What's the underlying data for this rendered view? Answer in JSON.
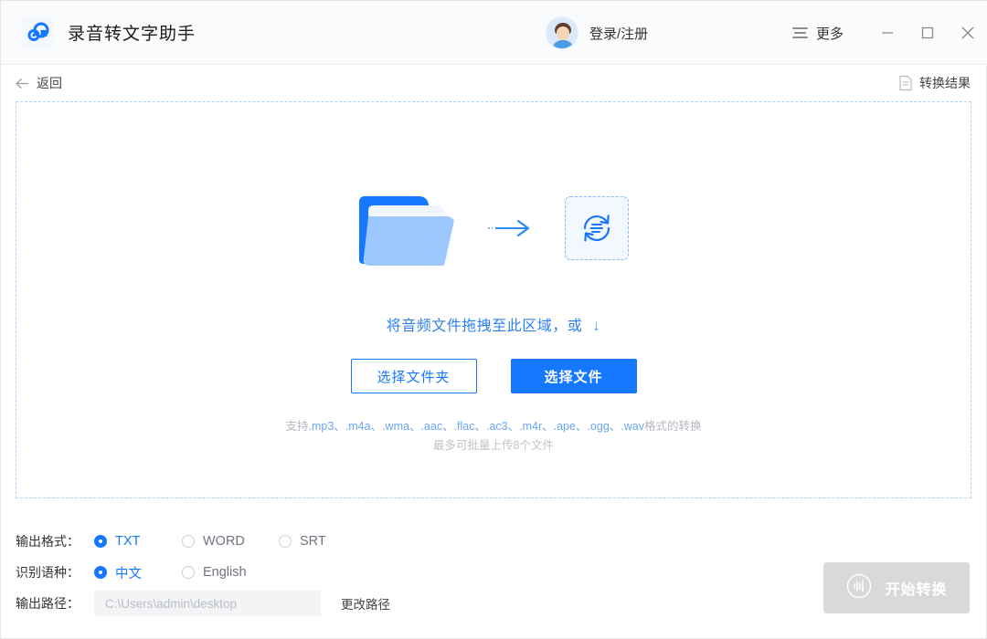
{
  "titlebar": {
    "app_title": "录音转文字助手",
    "logo_icon": "app-logo-icon",
    "avatar_icon": "user-avatar",
    "login_label": "登录/注册",
    "more_label": "更多",
    "more_icon": "hamburger-menu-icon",
    "minimize_icon": "minimize-icon",
    "maximize_icon": "maximize-icon",
    "close_icon": "close-icon"
  },
  "subbar": {
    "back_label": "返回",
    "back_icon": "arrow-left-icon",
    "result_label": "转换结果",
    "result_icon": "document-icon"
  },
  "dropzone": {
    "folder_icon": "folder-icon",
    "arrow_icon": "arrow-right-icon",
    "convert_icon": "convert-circle-icon",
    "hint_text": "将音频文件拖拽至此区域，或",
    "hint_arrow": "↓",
    "select_folder_label": "选择文件夹",
    "select_file_label": "选择文件",
    "formats_prefix": "支持",
    "formats_list": ".mp3、.m4a、.wma、.aac、.flac、.ac3、.m4r、.ape、.ogg、.wav",
    "formats_suffix": "格式的转换",
    "limit_text": "最多可批量上传8个文件"
  },
  "settings": {
    "output_format_label": "输出格式：",
    "output_format_options": [
      {
        "label": "TXT",
        "selected": true
      },
      {
        "label": "WORD",
        "selected": false
      },
      {
        "label": "SRT",
        "selected": false
      }
    ],
    "language_label": "识别语种：",
    "language_options": [
      {
        "label": "中文",
        "selected": true
      },
      {
        "label": "English",
        "selected": false
      }
    ],
    "output_path_label": "输出路径：",
    "output_path_value": "",
    "output_path_placeholder": "C:\\Users\\admin\\desktop",
    "change_path_label": "更改路径"
  },
  "action": {
    "start_label": "开始转换",
    "start_icon": "audio-wave-circle-icon",
    "start_disabled": true
  },
  "colors": {
    "accent": "#1677ff",
    "accent_light": "#9cc8fd",
    "dashed_border": "#afd0f5",
    "disabled_button": "#d9d9d9",
    "titlebar_bg": "#fafbfc"
  }
}
